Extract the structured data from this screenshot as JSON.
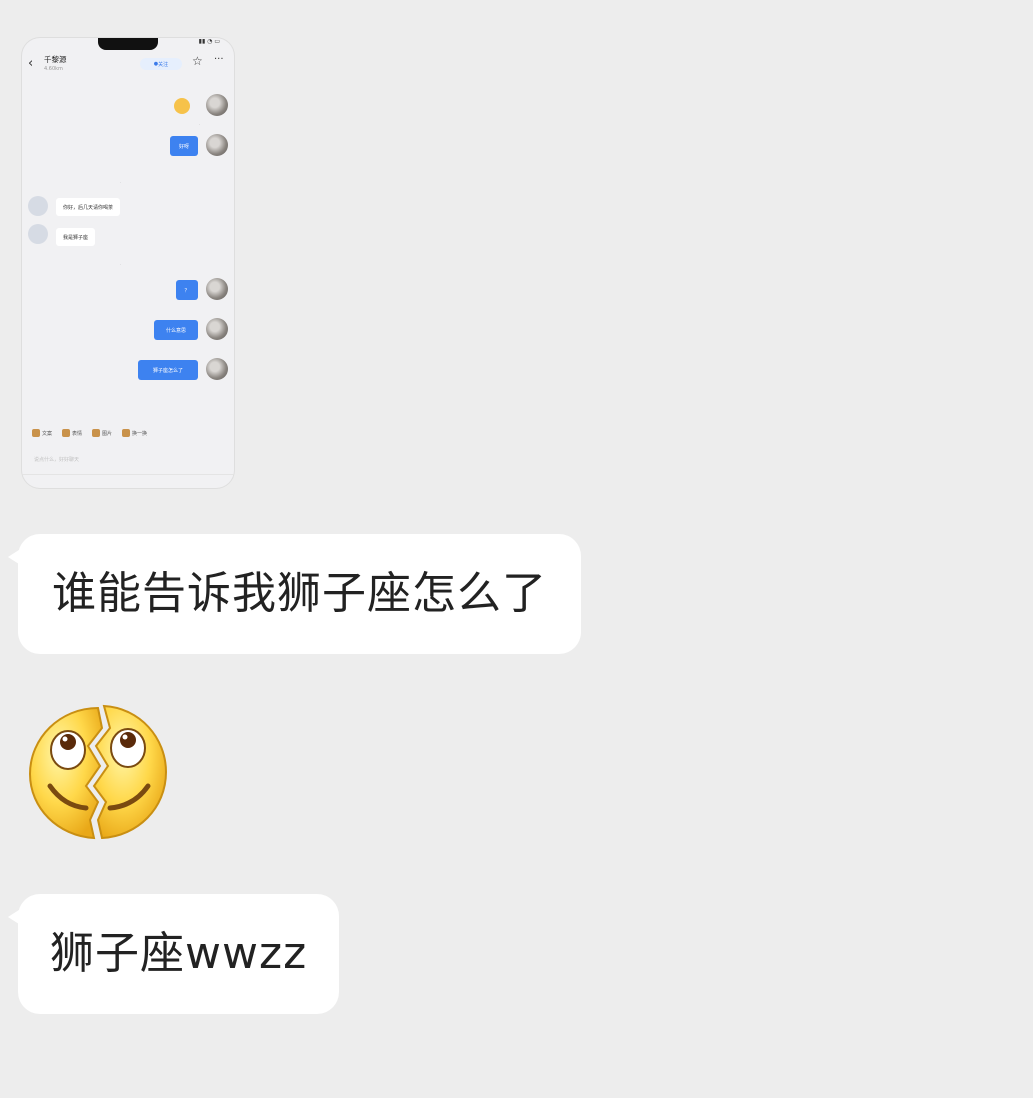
{
  "messages": {
    "text1": "谁能告诉我狮子座怎么了",
    "text2": "狮子座wwzz",
    "sticker": "broken-smile-sticker"
  },
  "screenshot": {
    "contact_name": "千黎源",
    "contact_sub": "4.60km",
    "follow_label": "关注",
    "incoming": [
      "你好，后几天请你喝茶",
      "我是狮子座"
    ],
    "outgoing": [
      "好呀",
      "？",
      "什么意思",
      "狮子座怎么了"
    ],
    "toolbar": [
      "文案",
      "表情",
      "图片",
      "换一换"
    ],
    "input_placeholder": "说点什么，好好聊天"
  },
  "colors": {
    "background": "#ededed",
    "bubble": "#ffffff",
    "phone_bubble_blue": "#3d82f0"
  }
}
